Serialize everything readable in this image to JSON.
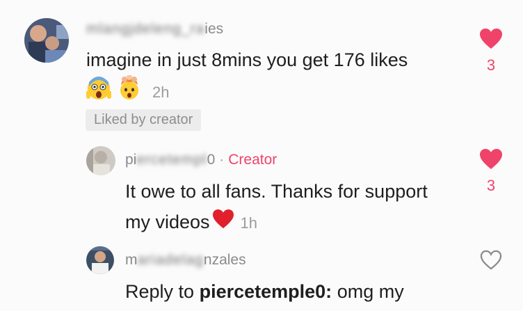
{
  "comments": [
    {
      "username_visible": "ies",
      "username_blurred": "mlangjdeleng_ra",
      "text": "imagine in just 8mins you get 176 likes",
      "emojis": [
        "screaming-face",
        "exploding-head"
      ],
      "time": "2h",
      "badge": "Liked by creator",
      "likes": "3",
      "liked": true
    },
    {
      "username_visible": "pi",
      "username_blurred": "ercetempl",
      "username_tail": "0",
      "separator": "·",
      "creator_label": "Creator",
      "text_line1": "It owe to all fans. Thanks for support",
      "text_line2": "my videos",
      "time": "1h",
      "likes": "3",
      "liked": true
    },
    {
      "username_visible": "m",
      "username_blurred": "ariadelag",
      "username_tail": "nzales",
      "reply_prefix": "Reply to",
      "reply_target": "piercetemple0:",
      "text": "omg my",
      "liked": false
    }
  ],
  "colors": {
    "accent": "#f0436a",
    "muted": "#8a8a8a",
    "background": "#fbfbfb"
  }
}
